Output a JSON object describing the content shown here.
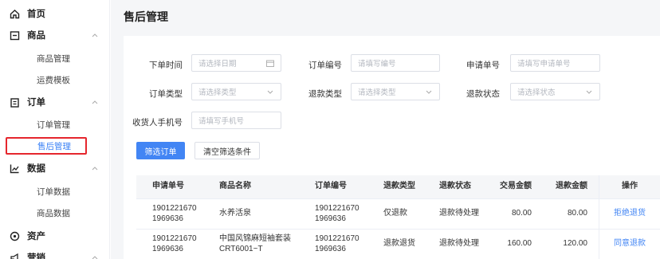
{
  "sidebar": {
    "home": "首页",
    "goods": "商品",
    "goods_items": [
      "商品管理",
      "运费模板"
    ],
    "orders": "订单",
    "order_items": [
      "订单管理",
      "售后管理"
    ],
    "data": "数据",
    "data_items": [
      "订单数据",
      "商品数据"
    ],
    "assets": "资产",
    "marketing": "营销"
  },
  "main": {
    "title": "售后管理"
  },
  "filters": {
    "order_time": {
      "label": "下单时间",
      "placeholder": "请选择日期"
    },
    "order_no": {
      "label": "订单编号",
      "placeholder": "请填写编号"
    },
    "apply_no": {
      "label": "申请单号",
      "placeholder": "请填写申请单号"
    },
    "order_type": {
      "label": "订单类型",
      "placeholder": "请选择类型"
    },
    "refund_type": {
      "label": "退款类型",
      "placeholder": "请选择类型"
    },
    "refund_status": {
      "label": "退款状态",
      "placeholder": "请选择状态"
    },
    "phone": {
      "label": "收货人手机号",
      "placeholder": "请填写手机号"
    },
    "filter_button": "筛选订单",
    "clear_button": "清空筛选条件"
  },
  "table": {
    "headers": [
      "申请单号",
      "商品名称",
      "订单编号",
      "退款类型",
      "退款状态",
      "交易金额",
      "退款金额",
      "操作"
    ],
    "rows": [
      {
        "apply_no_1": "1901221670",
        "apply_no_2": "1969636",
        "product_1": "水养活泉",
        "product_2": "",
        "order_no_1": "1901221670",
        "order_no_2": "1969636",
        "refund_type": "仅退款",
        "refund_status": "退款待处理",
        "trade_amount": "80.00",
        "refund_amount": "80.00",
        "action": "拒绝退货"
      },
      {
        "apply_no_1": "1901221670",
        "apply_no_2": "1969636",
        "product_1": "中国风锦麻短袖套装",
        "product_2": "CRT6001~T",
        "order_no_1": "1901221670",
        "order_no_2": "1969636",
        "refund_type": "退款退货",
        "refund_status": "退款待处理",
        "trade_amount": "160.00",
        "refund_amount": "120.00",
        "action": "同意退款"
      }
    ]
  },
  "colors": {
    "primary": "#4285f4",
    "highlight_border": "#e5262d"
  }
}
